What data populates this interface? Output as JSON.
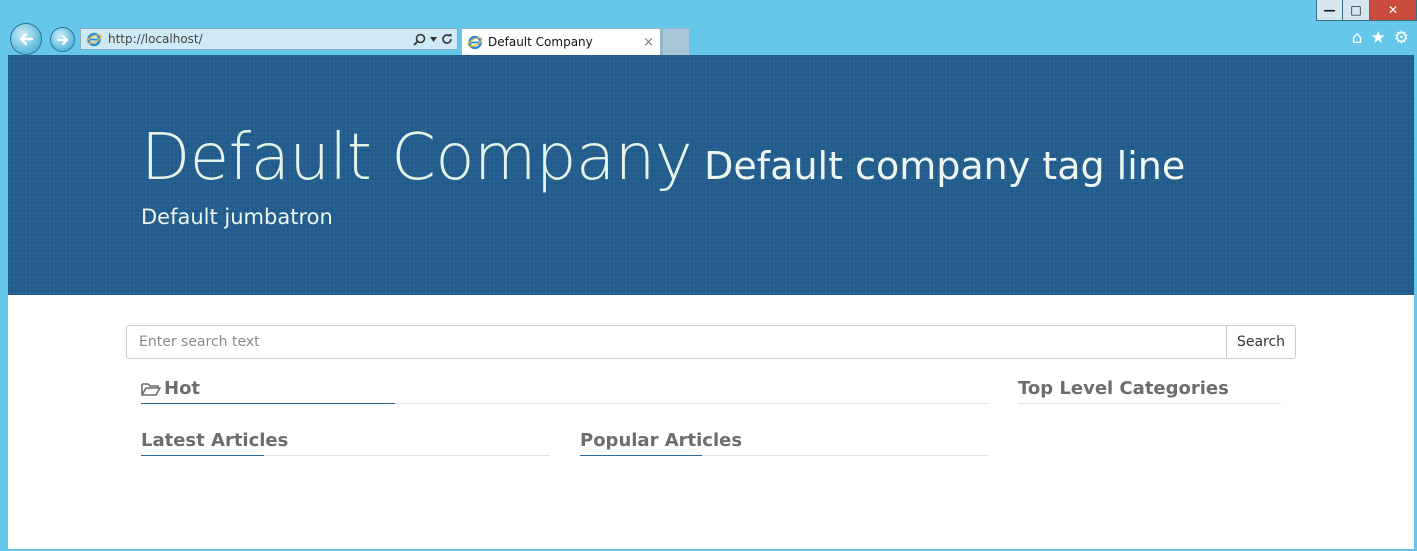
{
  "browser": {
    "address_url": "http://localhost/",
    "tab_title": "Default Company",
    "tab_close": "×",
    "win_min": "—",
    "win_max": "□",
    "win_close": "✕",
    "home_icon": "⌂",
    "favorites_icon": "★",
    "tools_icon": "⚙"
  },
  "jumbotron": {
    "company_name": "Default Company",
    "tag_line": "Default company tag line",
    "subtitle": "Default jumbatron"
  },
  "search": {
    "placeholder": "Enter search text",
    "button_label": "Search"
  },
  "sections": {
    "hot": "Hot",
    "top_level": "Top Level Categories",
    "latest": "Latest Articles",
    "popular": "Popular Articles"
  },
  "colors": {
    "chrome": "#65c7ea",
    "jumbotron": "#235d8e",
    "heading": "#6d6d6d",
    "accent_underline": "#2b6a98",
    "close_button": "#c94c3e"
  }
}
